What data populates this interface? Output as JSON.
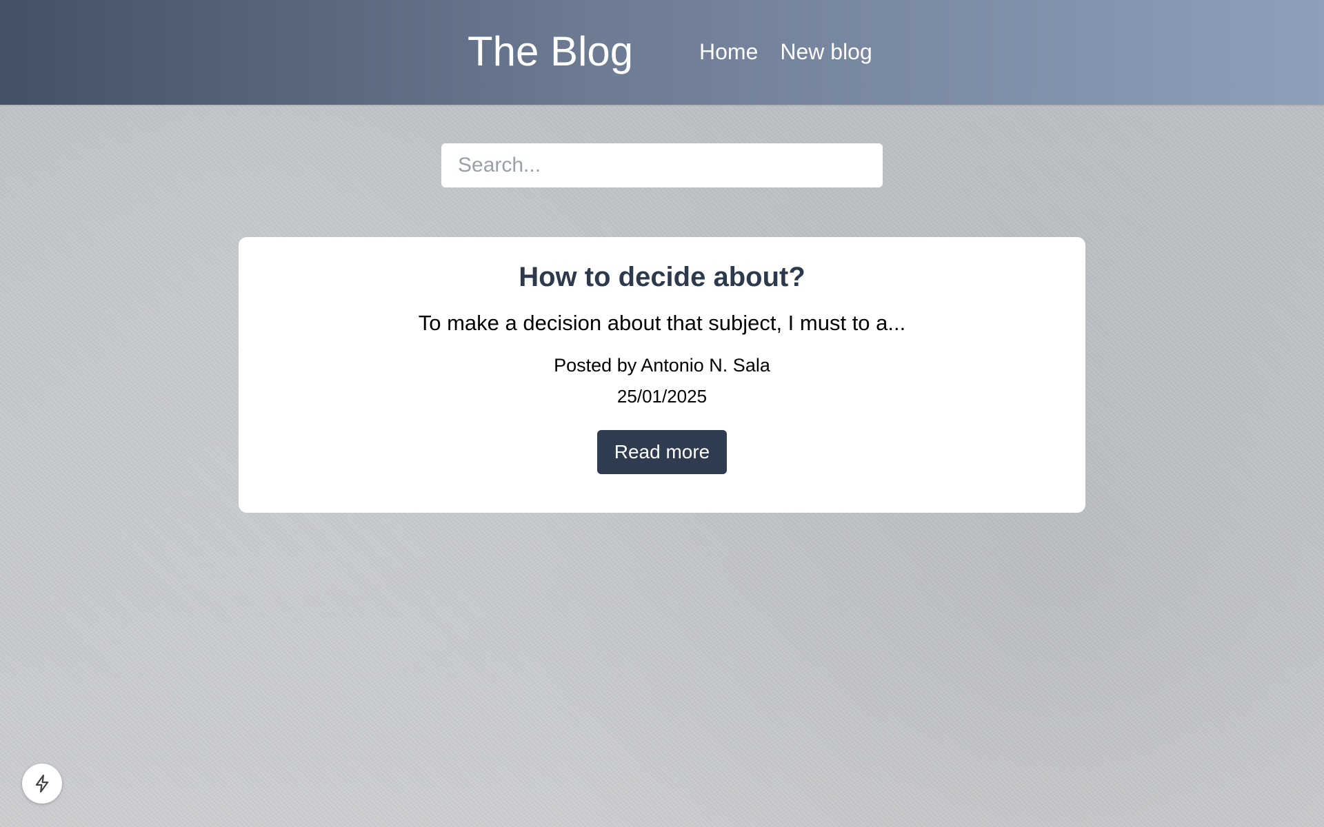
{
  "header": {
    "brand": "The Blog",
    "nav": [
      {
        "label": "Home"
      },
      {
        "label": "New blog"
      }
    ]
  },
  "search": {
    "placeholder": "Search...",
    "value": ""
  },
  "posts": [
    {
      "title": "How to decide about?",
      "excerpt": "To make a decision about that subject, I must to a...",
      "author": "Posted by Antonio N. Sala",
      "date": "25/01/2025",
      "button_label": "Read more"
    }
  ],
  "fab": {
    "icon": "lightning-icon"
  },
  "colors": {
    "header_gradient_start": "#445165",
    "header_gradient_end": "#8f9fba",
    "title": "#2d3a4d",
    "button": "#2f3b4f",
    "card": "#ffffff"
  }
}
